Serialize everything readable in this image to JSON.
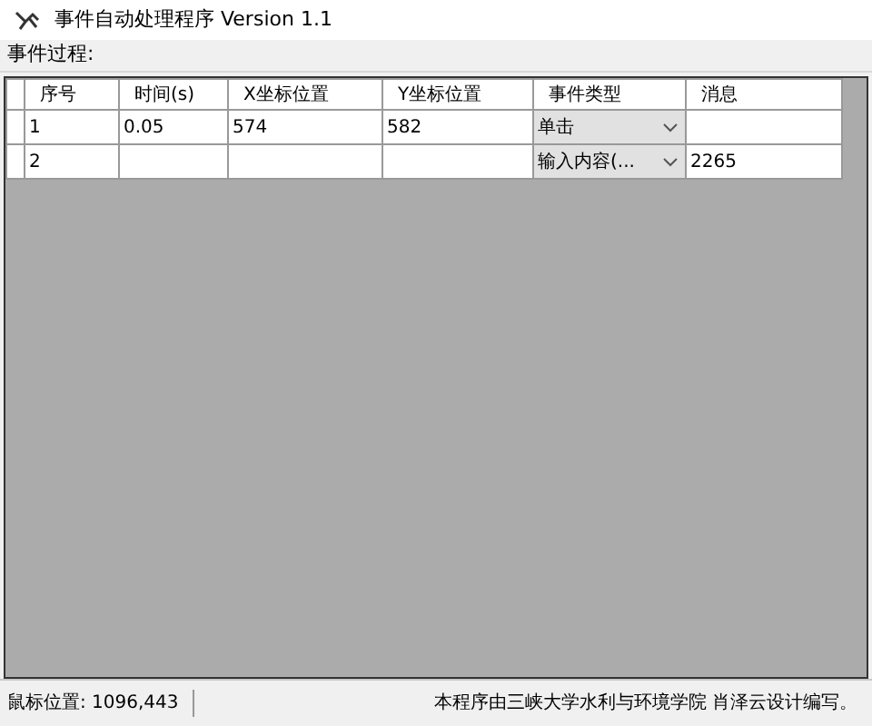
{
  "window": {
    "title": "事件自动处理程序 Version 1.1"
  },
  "section_label": "事件过程:",
  "table": {
    "columns": [
      "序号",
      "时间(s)",
      "X坐标位置",
      "Y坐标位置",
      "事件类型",
      "消息"
    ],
    "rows": [
      {
        "cells": [
          "1",
          "0.05",
          "574",
          "582",
          "单击",
          ""
        ]
      },
      {
        "cells": [
          "2",
          "",
          "",
          "",
          "输入内容(...",
          "2265"
        ]
      }
    ]
  },
  "status_bar": {
    "mouse_position": "鼠标位置: 1096,443",
    "credit": "本程序由三峡大学水利与环境学院 肖泽云设计编写。"
  }
}
